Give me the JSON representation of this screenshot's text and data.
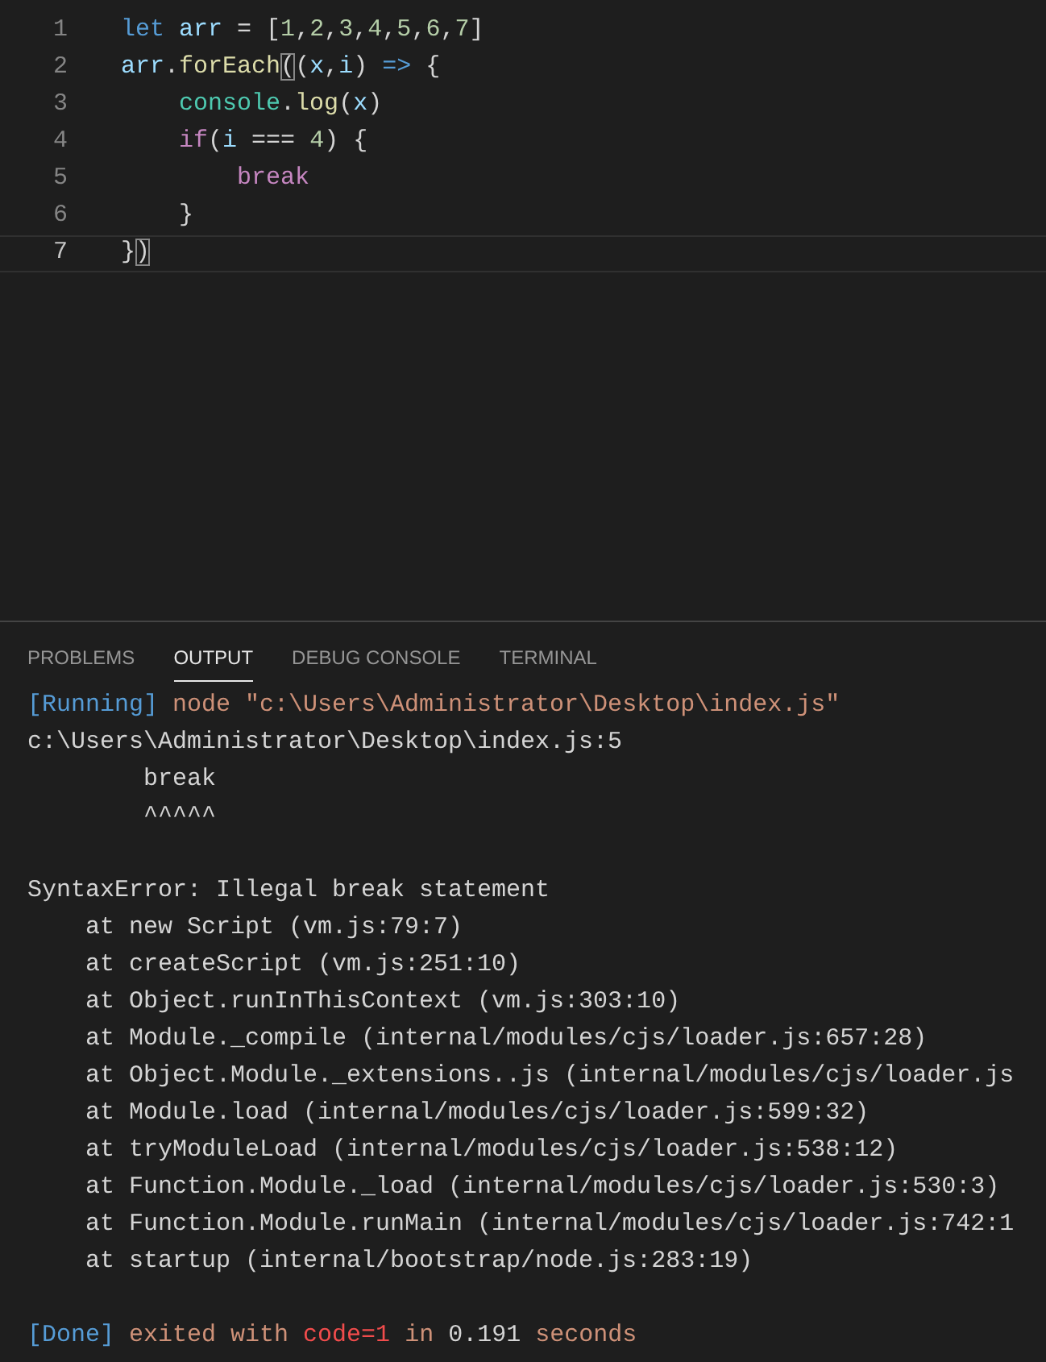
{
  "editor": {
    "lines": [
      {
        "number": "1",
        "current": false,
        "tokens": [
          {
            "text": "let",
            "kind": "keyword"
          },
          {
            "text": " arr",
            "kind": "variable"
          },
          {
            "text": " = [",
            "kind": "plain"
          },
          {
            "text": "1",
            "kind": "number"
          },
          {
            "text": ",",
            "kind": "plain"
          },
          {
            "text": "2",
            "kind": "number"
          },
          {
            "text": ",",
            "kind": "plain"
          },
          {
            "text": "3",
            "kind": "number"
          },
          {
            "text": ",",
            "kind": "plain"
          },
          {
            "text": "4",
            "kind": "number"
          },
          {
            "text": ",",
            "kind": "plain"
          },
          {
            "text": "5",
            "kind": "number"
          },
          {
            "text": ",",
            "kind": "plain"
          },
          {
            "text": "6",
            "kind": "number"
          },
          {
            "text": ",",
            "kind": "plain"
          },
          {
            "text": "7",
            "kind": "number"
          },
          {
            "text": "]",
            "kind": "plain"
          }
        ]
      },
      {
        "number": "2",
        "current": false,
        "tokens": [
          {
            "text": "arr",
            "kind": "variable"
          },
          {
            "text": ".",
            "kind": "plain"
          },
          {
            "text": "forEach",
            "kind": "function"
          },
          {
            "text": "(",
            "kind": "match"
          },
          {
            "text": "(",
            "kind": "plain"
          },
          {
            "text": "x",
            "kind": "variable"
          },
          {
            "text": ",",
            "kind": "plain"
          },
          {
            "text": "i",
            "kind": "variable"
          },
          {
            "text": ") ",
            "kind": "plain"
          },
          {
            "text": "=>",
            "kind": "keyword"
          },
          {
            "text": " {",
            "kind": "plain"
          }
        ]
      },
      {
        "number": "3",
        "current": false,
        "tokens": [
          {
            "text": "    console",
            "kind": "class"
          },
          {
            "text": ".",
            "kind": "plain"
          },
          {
            "text": "log",
            "kind": "function"
          },
          {
            "text": "(",
            "kind": "plain"
          },
          {
            "text": "x",
            "kind": "variable"
          },
          {
            "text": ")",
            "kind": "plain"
          }
        ]
      },
      {
        "number": "4",
        "current": false,
        "tokens": [
          {
            "text": "    if",
            "kind": "control"
          },
          {
            "text": "(",
            "kind": "plain"
          },
          {
            "text": "i",
            "kind": "variable"
          },
          {
            "text": " === ",
            "kind": "plain"
          },
          {
            "text": "4",
            "kind": "number"
          },
          {
            "text": ") {",
            "kind": "plain"
          }
        ]
      },
      {
        "number": "5",
        "current": false,
        "tokens": [
          {
            "text": "        break",
            "kind": "control"
          }
        ]
      },
      {
        "number": "6",
        "current": false,
        "tokens": [
          {
            "text": "    }",
            "kind": "plain"
          }
        ]
      },
      {
        "number": "7",
        "current": true,
        "tokens": [
          {
            "text": "}",
            "kind": "plain"
          },
          {
            "text": ")",
            "kind": "match"
          }
        ]
      }
    ]
  },
  "panel": {
    "tabs": [
      {
        "label": "PROBLEMS",
        "selected": false
      },
      {
        "label": "OUTPUT",
        "selected": true
      },
      {
        "label": "DEBUG CONSOLE",
        "selected": false
      },
      {
        "label": "TERMINAL",
        "selected": false
      }
    ],
    "output": [
      {
        "gap_before": false,
        "tokens": [
          {
            "text": "[Running]",
            "kind": "info"
          },
          {
            "text": " node \"c:\\Users\\Administrator\\Desktop\\index.js\"",
            "kind": "string"
          }
        ]
      },
      {
        "gap_before": false,
        "tokens": [
          {
            "text": "c:\\Users\\Administrator\\Desktop\\index.js:5",
            "kind": "plain"
          }
        ]
      },
      {
        "gap_before": false,
        "tokens": [
          {
            "text": "        break",
            "kind": "plain"
          }
        ]
      },
      {
        "gap_before": false,
        "tokens": [
          {
            "text": "        ^^^^^",
            "kind": "plain"
          }
        ]
      },
      {
        "gap_before": true,
        "tokens": [
          {
            "text": "SyntaxError: Illegal break statement",
            "kind": "plain"
          }
        ]
      },
      {
        "gap_before": false,
        "tokens": [
          {
            "text": "    at new Script (vm.js:79:7)",
            "kind": "plain"
          }
        ]
      },
      {
        "gap_before": false,
        "tokens": [
          {
            "text": "    at createScript (vm.js:251:10)",
            "kind": "plain"
          }
        ]
      },
      {
        "gap_before": false,
        "tokens": [
          {
            "text": "    at Object.runInThisContext (vm.js:303:10)",
            "kind": "plain"
          }
        ]
      },
      {
        "gap_before": false,
        "tokens": [
          {
            "text": "    at Module._compile (internal/modules/cjs/loader.js:657:28)",
            "kind": "plain"
          }
        ]
      },
      {
        "gap_before": false,
        "tokens": [
          {
            "text": "    at Object.Module._extensions..js (internal/modules/cjs/loader.js",
            "kind": "plain"
          }
        ]
      },
      {
        "gap_before": false,
        "tokens": [
          {
            "text": "    at Module.load (internal/modules/cjs/loader.js:599:32)",
            "kind": "plain"
          }
        ]
      },
      {
        "gap_before": false,
        "tokens": [
          {
            "text": "    at tryModuleLoad (internal/modules/cjs/loader.js:538:12)",
            "kind": "plain"
          }
        ]
      },
      {
        "gap_before": false,
        "tokens": [
          {
            "text": "    at Function.Module._load (internal/modules/cjs/loader.js:530:3)",
            "kind": "plain"
          }
        ]
      },
      {
        "gap_before": false,
        "tokens": [
          {
            "text": "    at Function.Module.runMain (internal/modules/cjs/loader.js:742:1",
            "kind": "plain"
          }
        ]
      },
      {
        "gap_before": false,
        "tokens": [
          {
            "text": "    at startup (internal/bootstrap/node.js:283:19)",
            "kind": "plain"
          }
        ]
      },
      {
        "gap_before": true,
        "tokens": [
          {
            "text": "[Done]",
            "kind": "info"
          },
          {
            "text": " exited with ",
            "kind": "string"
          },
          {
            "text": "code=1",
            "kind": "error"
          },
          {
            "text": " in ",
            "kind": "string"
          },
          {
            "text": "0.191",
            "kind": "plain"
          },
          {
            "text": " seconds",
            "kind": "string"
          }
        ]
      }
    ]
  }
}
